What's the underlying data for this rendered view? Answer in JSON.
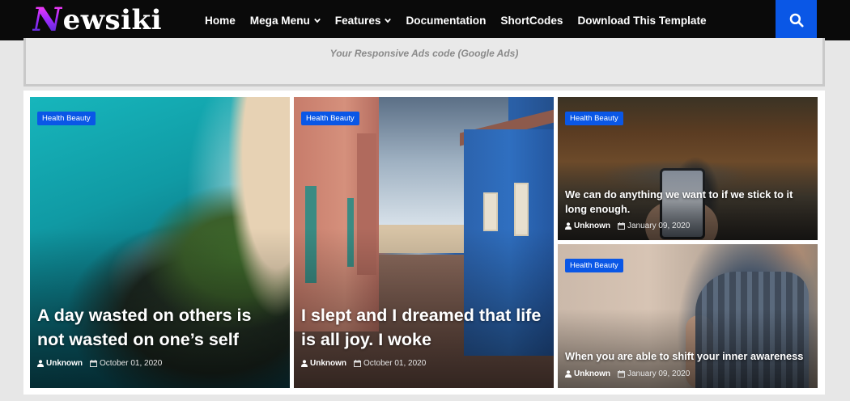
{
  "logo": {
    "first_letter": "N",
    "rest": "ewsiki"
  },
  "nav": {
    "items": [
      {
        "label": "Home",
        "has_caret": false
      },
      {
        "label": "Mega Menu",
        "has_caret": true
      },
      {
        "label": "Features",
        "has_caret": true
      },
      {
        "label": "Documentation",
        "has_caret": false
      },
      {
        "label": "ShortCodes",
        "has_caret": false
      },
      {
        "label": "Download This Template",
        "has_caret": false
      }
    ],
    "search_icon": "search-icon"
  },
  "ad": {
    "text": "Your Responsive Ads code (Google Ads)"
  },
  "posts": [
    {
      "category": "Health Beauty",
      "title": "A day wasted on others is not wasted on one’s self",
      "author": "Unknown",
      "date": "October 01, 2020"
    },
    {
      "category": "Health Beauty",
      "title": "I slept and I dreamed that life is all joy. I woke",
      "author": "Unknown",
      "date": "October 01, 2020"
    },
    {
      "category": "Health Beauty",
      "title": "We can do anything we want to if we stick to it long enough.",
      "author": "Unknown",
      "date": "January 09, 2020"
    },
    {
      "category": "Health Beauty",
      "title": "When you are able to shift your inner awareness",
      "author": "Unknown",
      "date": "January 09, 2020"
    }
  ],
  "colors": {
    "accent": "#0a57e6",
    "navbar": "#0a0a0a",
    "background": "#e7e7e7"
  }
}
